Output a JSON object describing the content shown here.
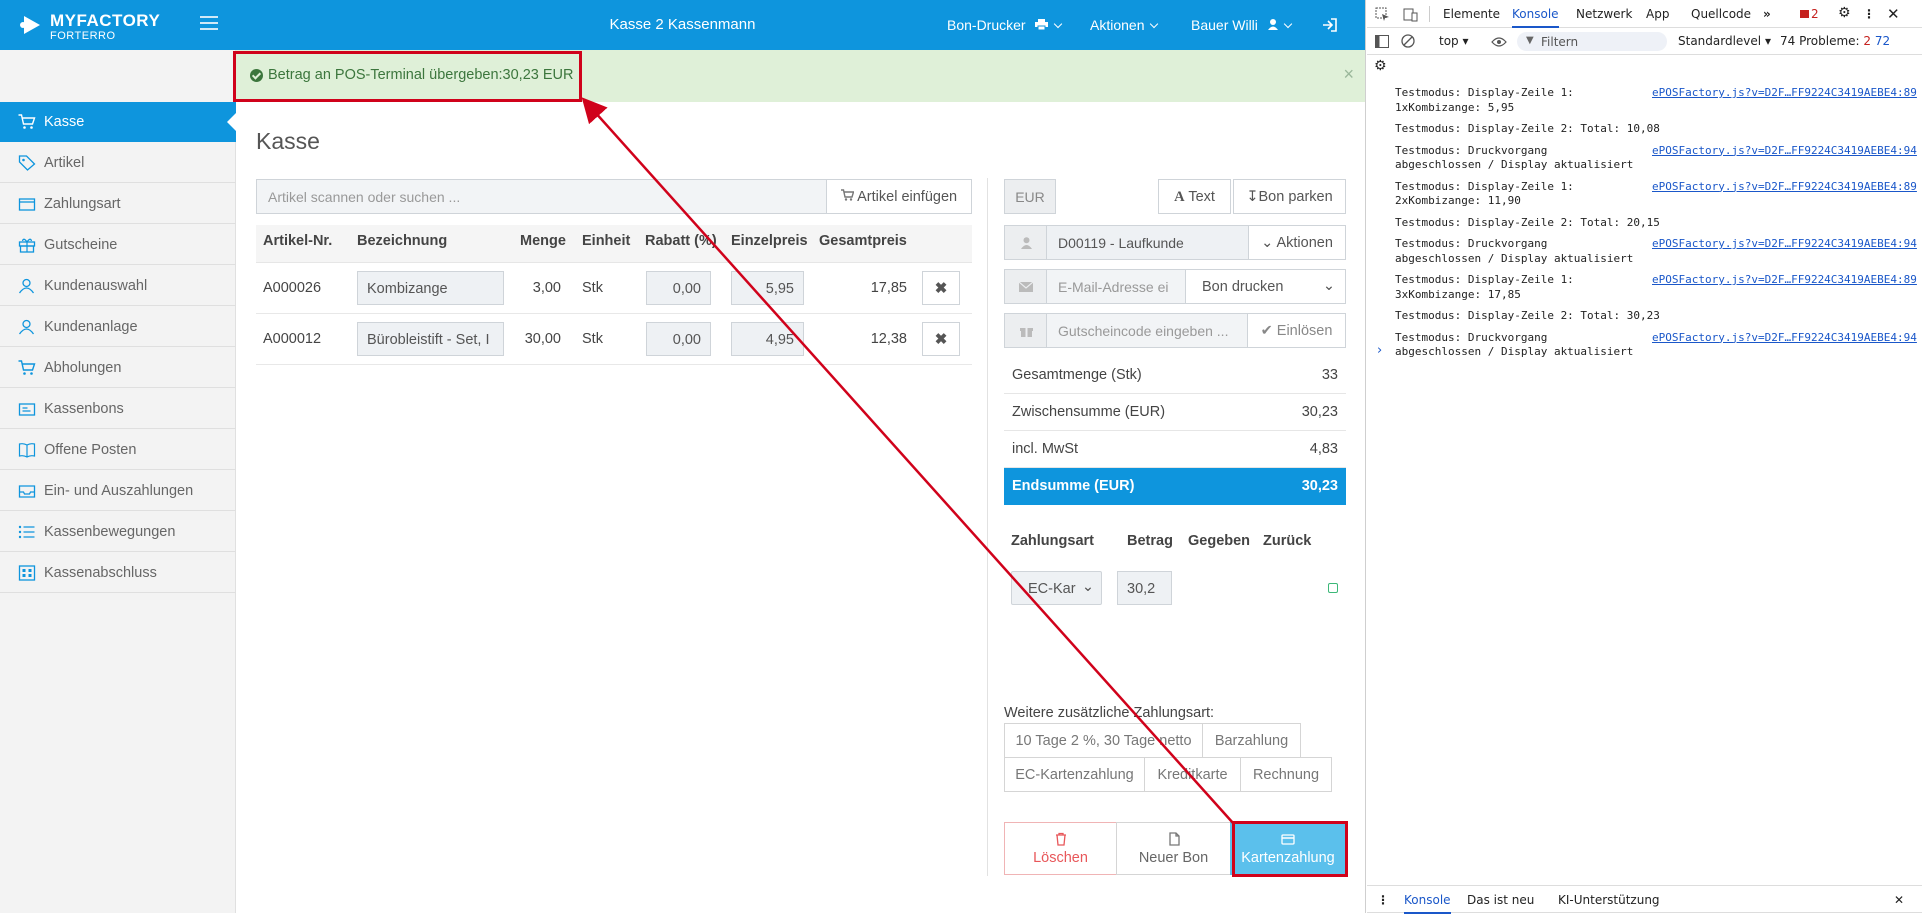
{
  "topbar": {
    "brand_line1": "MYFACTORY",
    "brand_line2": "FORTERRO",
    "title": "Kasse 2 Kassenmann",
    "bon_drucker": "Bon-Drucker",
    "aktionen": "Aktionen",
    "user": "Bauer Willi"
  },
  "alert": {
    "message": "Betrag an POS-Terminal übergeben:30,23 EUR",
    "close": "×"
  },
  "sidebar": {
    "items": [
      {
        "label": "Kasse",
        "icon": "cart-icon"
      },
      {
        "label": "Artikel",
        "icon": "tag-icon"
      },
      {
        "label": "Zahlungsart",
        "icon": "wallet-icon"
      },
      {
        "label": "Gutscheine",
        "icon": "gift-icon"
      },
      {
        "label": "Kundenauswahl",
        "icon": "user-icon"
      },
      {
        "label": "Kundenanlage",
        "icon": "user-icon"
      },
      {
        "label": "Abholungen",
        "icon": "cart-icon"
      },
      {
        "label": "Kassenbons",
        "icon": "receipt-icon"
      },
      {
        "label": "Offene Posten",
        "icon": "book-icon"
      },
      {
        "label": "Ein- und Auszahlungen",
        "icon": "inbox-icon"
      },
      {
        "label": "Kassenbewegungen",
        "icon": "list-icon"
      },
      {
        "label": "Kassenabschluss",
        "icon": "calculator-icon"
      }
    ]
  },
  "main": {
    "title": "Kasse",
    "search_placeholder": "Artikel scannen oder suchen ...",
    "add_button": "Artikel einfügen",
    "columns": [
      "Artikel-Nr.",
      "Bezeichnung",
      "Menge",
      "Einheit",
      "Rabatt (%)",
      "Einzelpreis",
      "Gesamtpreis"
    ],
    "rows": [
      {
        "nr": "A000026",
        "name": "Kombizange",
        "menge": "3,00",
        "einheit": "Stk",
        "rabatt": "0,00",
        "einzel": "5,95",
        "gesamt": "17,85"
      },
      {
        "nr": "A000012",
        "name": "Bürobleistift - Set, I",
        "menge": "30,00",
        "einheit": "Stk",
        "rabatt": "0,00",
        "einzel": "4,95",
        "gesamt": "12,38"
      }
    ]
  },
  "right": {
    "currency": "EUR",
    "text_button": "Text",
    "park_button": "Bon parken",
    "customer": "D00119 - Laufkunde",
    "customer_actions": "Aktionen",
    "email_placeholder": "E-Mail-Adresse ei",
    "print_select": "Bon drucken",
    "voucher_placeholder": "Gutscheincode eingeben ...",
    "redeem_button": "Einlösen",
    "summary": [
      {
        "label": "Gesamtmenge (Stk)",
        "value": "33"
      },
      {
        "label": "Zwischensumme (EUR)",
        "value": "30,23"
      },
      {
        "label": "incl. MwSt",
        "value": "4,83"
      }
    ],
    "total_label": "Endsumme (EUR)",
    "total_value": "30,23",
    "pay_headers": [
      "Zahlungsart",
      "Betrag",
      "Gegeben",
      "Zurück"
    ],
    "pay_method": "EC-Kar",
    "pay_amount": "30,2",
    "more_label": "Weitere zusätzliche Zahlungsart:",
    "more_methods": [
      "10 Tage 2 %, 30 Tage netto",
      "Barzahlung",
      "EC-Kartenzahlung",
      "Kreditkarte",
      "Rechnung"
    ],
    "delete_button": "Löschen",
    "new_button": "Neuer Bon",
    "card_button": "Kartenzahlung"
  },
  "devtools": {
    "tabs": [
      "Elemente",
      "Konsole",
      "Netzwerk",
      "App",
      "Quellcode"
    ],
    "errors_badge": "2",
    "context": "top",
    "filter_placeholder": "Filtern",
    "level": "Standardlevel",
    "problems": "74 Probleme:",
    "problems_err": "2",
    "problems_info": "72",
    "logs": [
      {
        "text": "Testmodus: Display-Zeile 1:\n1xKombizange: 5,95",
        "link": "ePOSFactory.js?v=D2F…FF9224C3419AEBE4:89"
      },
      {
        "text": "Testmodus: Display-Zeile 2: Total: 10,08",
        "link": ""
      },
      {
        "text": "Testmodus: Druckvorgang\nabgeschlossen / Display aktualisiert",
        "link": "ePOSFactory.js?v=D2F…FF9224C3419AEBE4:94"
      },
      {
        "text": "Testmodus: Display-Zeile 1:\n2xKombizange: 11,90",
        "link": "ePOSFactory.js?v=D2F…FF9224C3419AEBE4:89"
      },
      {
        "text": "Testmodus: Display-Zeile 2: Total: 20,15",
        "link": ""
      },
      {
        "text": "Testmodus: Druckvorgang\nabgeschlossen / Display aktualisiert",
        "link": "ePOSFactory.js?v=D2F…FF9224C3419AEBE4:94"
      },
      {
        "text": "Testmodus: Display-Zeile 1:\n3xKombizange: 17,85",
        "link": "ePOSFactory.js?v=D2F…FF9224C3419AEBE4:89"
      },
      {
        "text": "Testmodus: Display-Zeile 2: Total: 30,23",
        "link": ""
      },
      {
        "text": "Testmodus: Druckvorgang\nabgeschlossen / Display aktualisiert",
        "link": "ePOSFactory.js?v=D2F…FF9224C3419AEBE4:94"
      }
    ],
    "bottom_tabs": [
      "Konsole",
      "Das ist neu",
      "KI-Unterstützung"
    ]
  },
  "colors": {
    "accent": "#0e95dd",
    "success_bg": "#dff0d8",
    "annotation": "#d0021b",
    "card_button": "#5bc0ec"
  }
}
